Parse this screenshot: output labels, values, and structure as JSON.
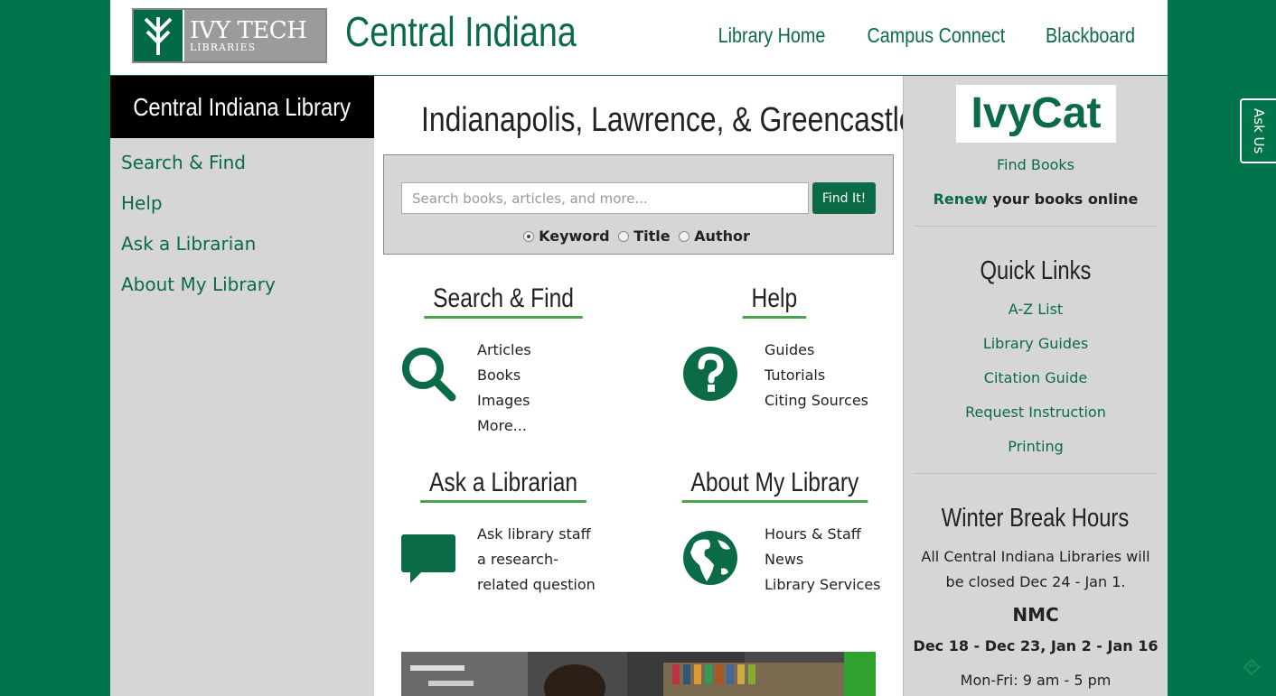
{
  "header": {
    "logo_text": "IVY TECH",
    "logo_subtext": "LIBRARIES",
    "site_title": "Central Indiana",
    "nav": [
      {
        "label": "Library Home"
      },
      {
        "label": "Campus Connect"
      },
      {
        "label": "Blackboard"
      }
    ]
  },
  "leftbar": {
    "title": "Central Indiana Library",
    "items": [
      {
        "label": "Search & Find"
      },
      {
        "label": "Help"
      },
      {
        "label": "Ask a Librarian"
      },
      {
        "label": "About My Library"
      }
    ]
  },
  "main": {
    "campus_heading": "Indianapolis, Lawrence, & Greencastle",
    "search": {
      "placeholder": "Search books, articles, and more...",
      "button_label": "Find It!",
      "options": [
        {
          "label": "Keyword",
          "selected": true
        },
        {
          "label": "Title",
          "selected": false
        },
        {
          "label": "Author",
          "selected": false
        }
      ]
    },
    "sections": {
      "search_find": {
        "title": "Search & Find",
        "icon": "magnifier-icon",
        "links": [
          "Articles",
          "Books",
          "Images",
          "More..."
        ]
      },
      "help": {
        "title": "Help",
        "icon": "question-icon",
        "links": [
          "Guides",
          "Tutorials",
          "Citing Sources"
        ]
      },
      "ask": {
        "title": "Ask a Librarian",
        "icon": "chat-bubble-icon",
        "links": [
          "Ask library staff",
          "a research-",
          "related question"
        ]
      },
      "about": {
        "title": "About My Library",
        "icon": "globe-icon",
        "links": [
          "Hours & Staff",
          "News",
          "Library Services"
        ]
      }
    }
  },
  "rightbar": {
    "ivycat": "IvyCat",
    "find_books": "Find Books",
    "renew_bold": "Renew",
    "renew_rest": " your books online",
    "quick_links_title": "Quick Links",
    "quick_links": [
      "A-Z List",
      "Library Guides",
      "Citation Guide",
      "Request Instruction",
      "Printing"
    ],
    "hours_title": "Winter Break Hours",
    "hours_note": "All Central Indiana Libraries will be closed Dec 24 - Jan 1.",
    "location": "NMC",
    "dates": "Dec 18 - Dec 23, Jan 2 - Jan 16",
    "weekday_hours": "Mon-Fri: 9 am - 5 pm"
  },
  "ask_us_tab": "Ask Us",
  "colors": {
    "brand_green": "#0b6b47",
    "page_bg": "#00744a",
    "sidebar_gray": "#d6d6d6",
    "accent_underline": "#4aa34a"
  }
}
